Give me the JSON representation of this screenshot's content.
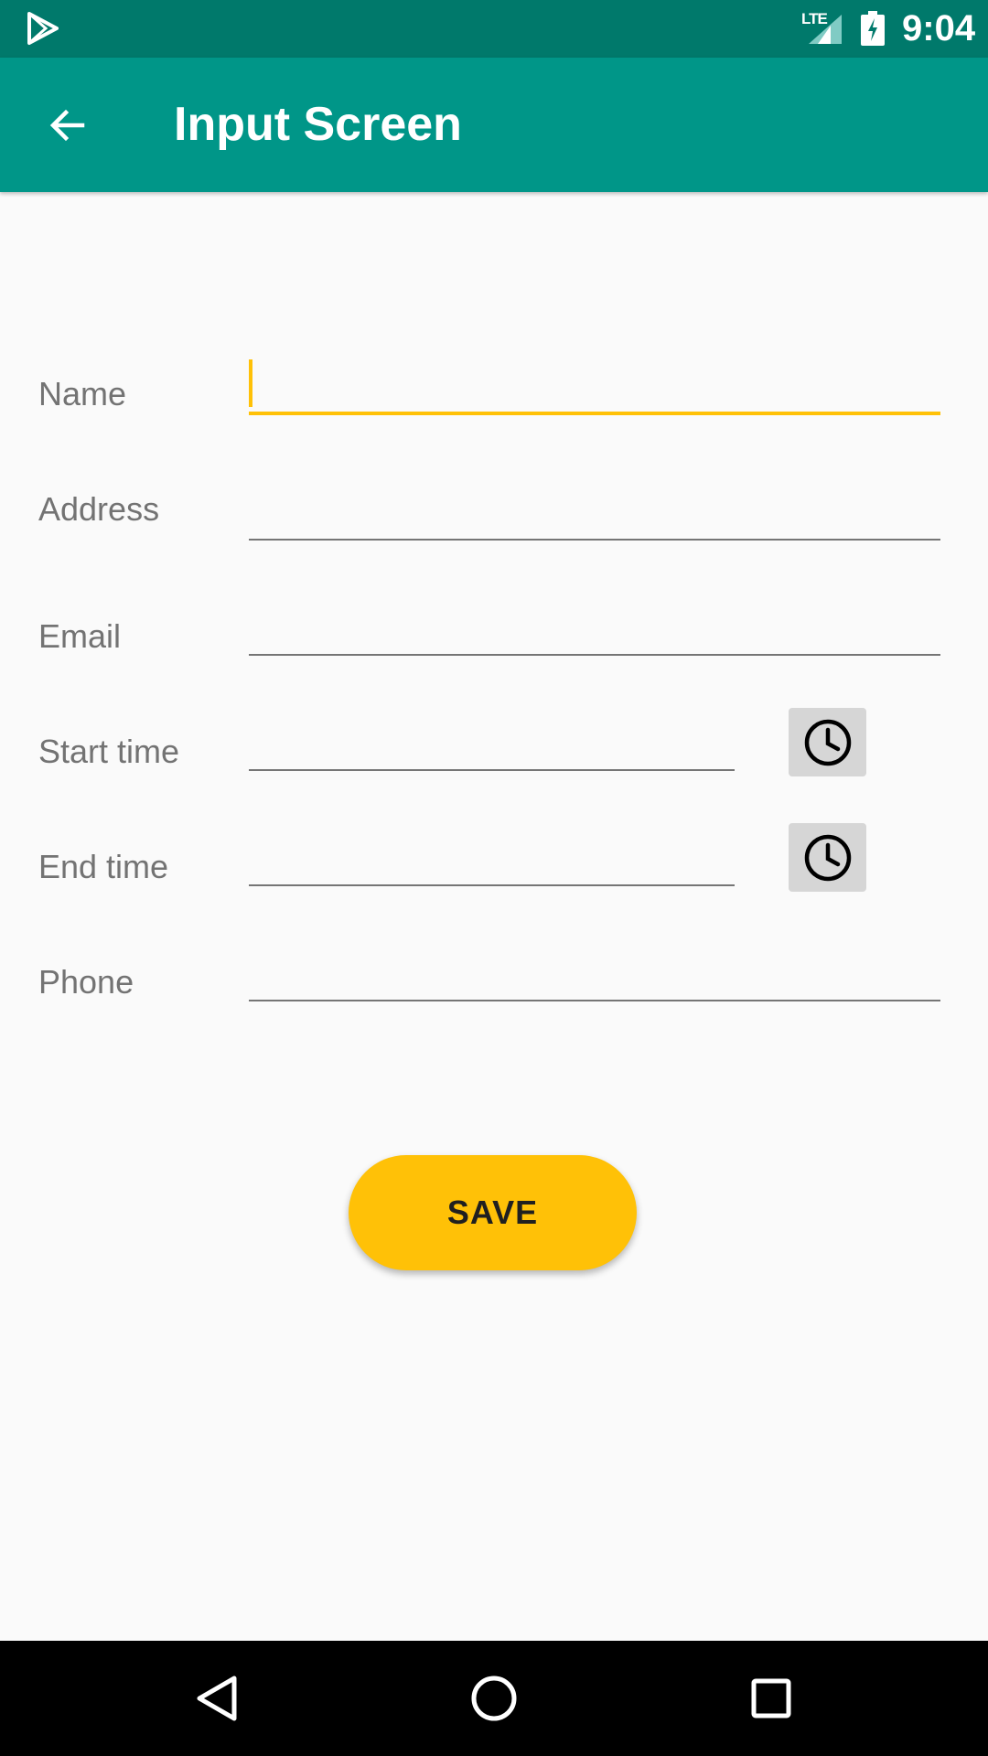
{
  "status_bar": {
    "network_label": "LTE",
    "time": "9:04",
    "icons": [
      "play-store-icon",
      "lte-signal-icon",
      "battery-charging-icon"
    ]
  },
  "app_bar": {
    "title": "Input Screen",
    "back_icon": "arrow-back-icon"
  },
  "form": {
    "fields": [
      {
        "label": "Name",
        "value": ""
      },
      {
        "label": "Address",
        "value": ""
      },
      {
        "label": "Email",
        "value": ""
      },
      {
        "label": "Start time",
        "value": ""
      },
      {
        "label": "End time",
        "value": ""
      },
      {
        "label": "Phone",
        "value": ""
      }
    ],
    "time_picker_icon": "clock-icon"
  },
  "save_button": {
    "label": "SAVE"
  },
  "nav_bar": {
    "icons": [
      "back-triangle-icon",
      "home-circle-icon",
      "recents-square-icon"
    ]
  },
  "colors": {
    "status_bar": "#00796B",
    "app_bar": "#009688",
    "accent": "#FFC107",
    "background": "#FAFAFA",
    "label_text": "#737373"
  }
}
